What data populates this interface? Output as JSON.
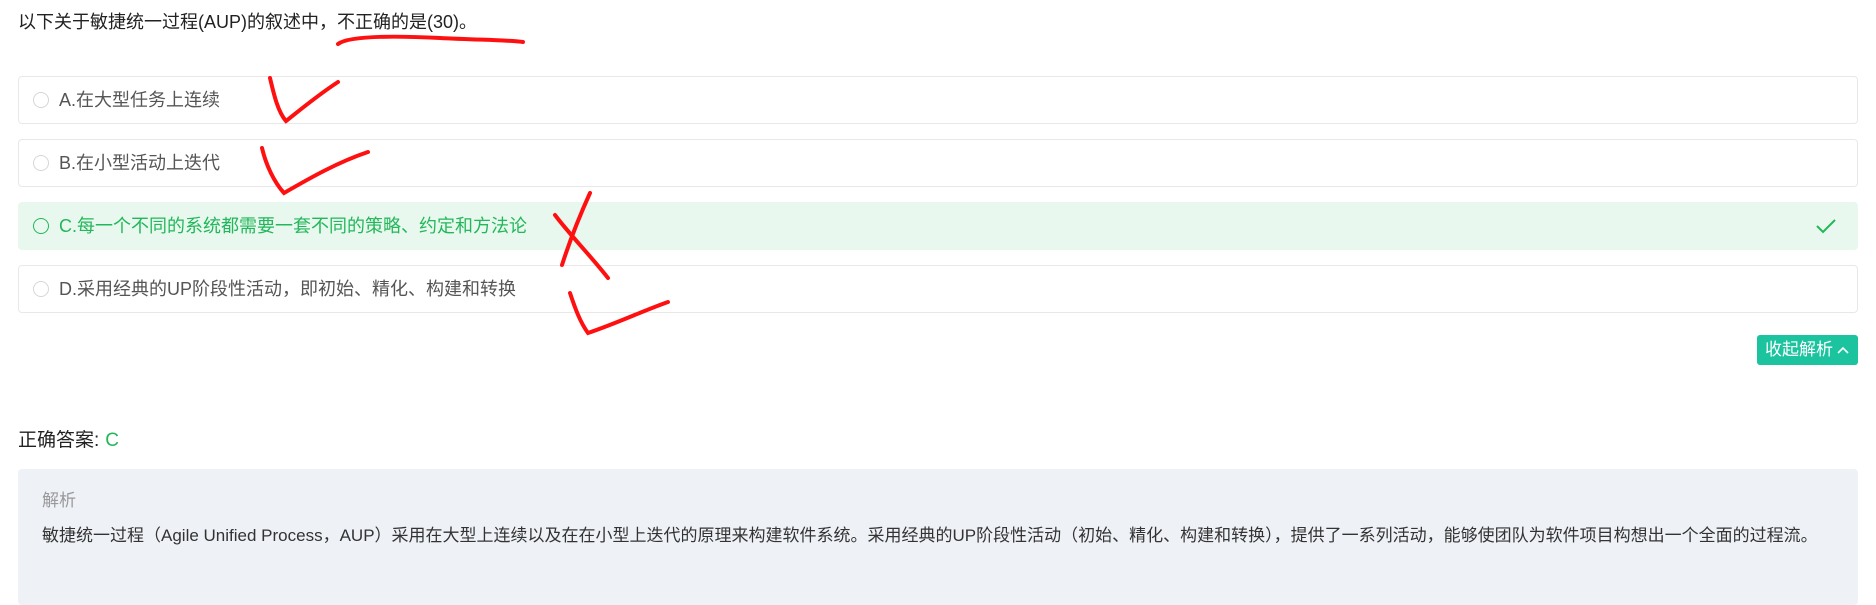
{
  "question": {
    "text_prefix": "以下关于敏捷统一过程(AUP)的叙述中，",
    "text_emphasis": "不正确的是(30)。"
  },
  "options": [
    {
      "label": "A.在大型任务上连续",
      "correct": false
    },
    {
      "label": "B.在小型活动上迭代",
      "correct": false
    },
    {
      "label": "C.每一个不同的系统都需要一套不同的策略、约定和方法论",
      "correct": true
    },
    {
      "label": "D.采用经典的UP阶段性活动，即初始、精化、构建和转换",
      "correct": false
    }
  ],
  "collapse_button": {
    "label": "收起解析"
  },
  "answer": {
    "label": "正确答案:",
    "value": "C"
  },
  "analysis": {
    "title": "解析",
    "text": "敏捷统一过程（Agile Unified Process，AUP）采用在大型上连续以及在在小型上迭代的原理来构建软件系统。采用经典的UP阶段性活动（初始、精化、构建和转换），提供了一系列活动，能够使团队为软件项目构想出一个全面的过程流。"
  },
  "colors": {
    "correct_green": "#22b75a",
    "correct_bg": "#e9f8ee",
    "button_teal": "#1cc39f",
    "analysis_bg": "#eef1f6",
    "annotation_red": "#ff0000"
  }
}
